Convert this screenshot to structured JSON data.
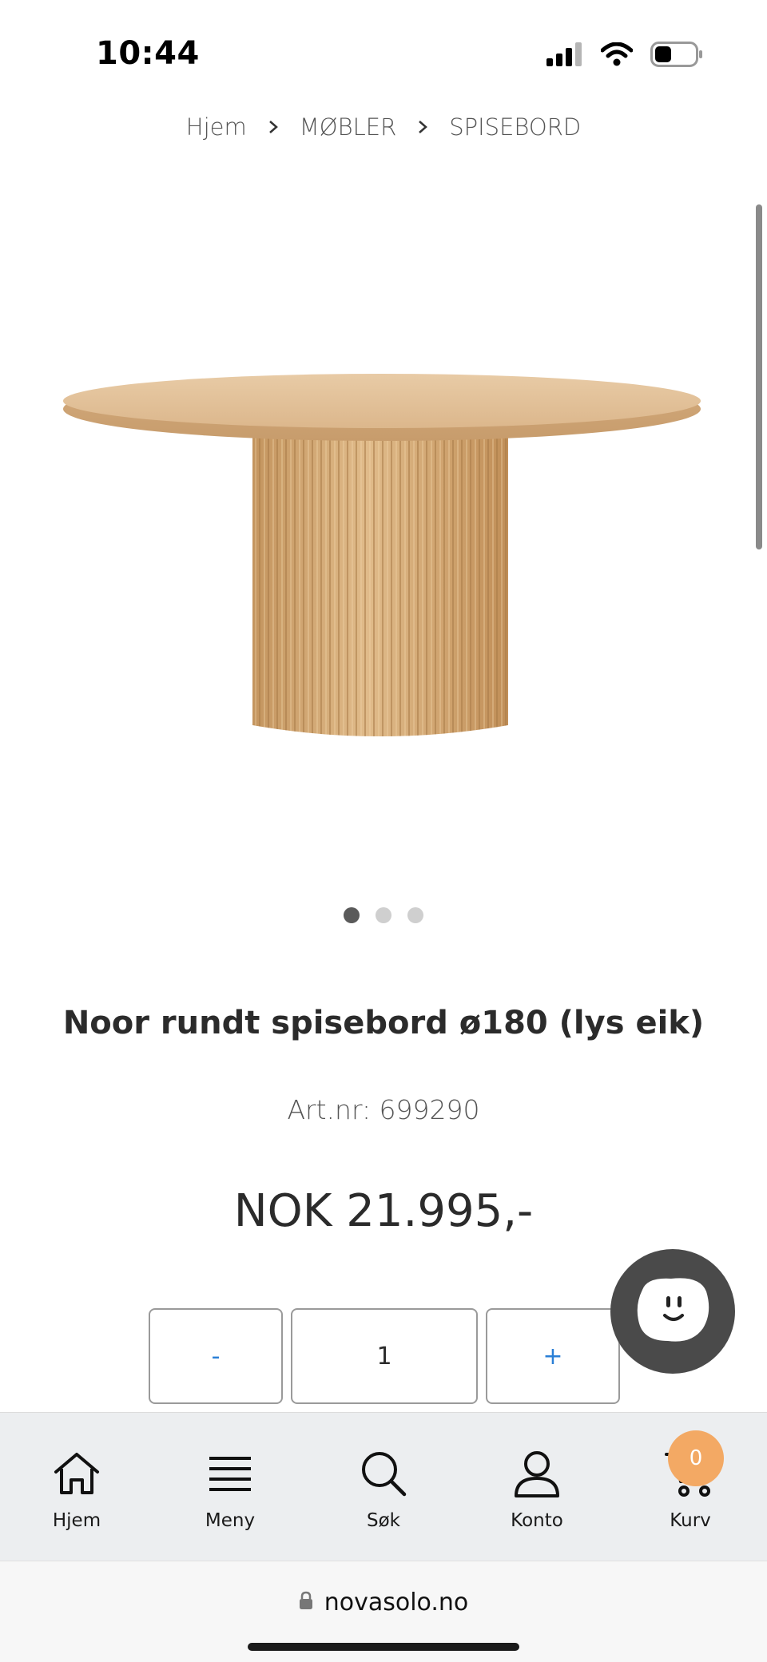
{
  "status_bar": {
    "time": "10:44",
    "icons": [
      "signal-icon",
      "wifi-icon",
      "battery-icon"
    ]
  },
  "breadcrumb": {
    "items": [
      "Hjem",
      "MØBLER",
      "SPISEBORD"
    ]
  },
  "product": {
    "image_alt": "round oak dining table with fluted pedestal",
    "carousel": {
      "total": 3,
      "active": 1
    },
    "title": "Noor rundt spisebord ø180 (lys eik)",
    "art_nr": "Art.nr: 699290",
    "price": "NOK 21.995,-"
  },
  "quantity": {
    "minus_label": "-",
    "value": "1",
    "plus_label": "+"
  },
  "chat": {
    "icon": "chat-face-icon"
  },
  "bottom_nav": {
    "items": [
      {
        "label": "Hjem",
        "icon": "home-icon"
      },
      {
        "label": "Meny",
        "icon": "menu-icon"
      },
      {
        "label": "Søk",
        "icon": "search-icon"
      },
      {
        "label": "Konto",
        "icon": "user-icon"
      },
      {
        "label": "Kurv",
        "icon": "cart-icon"
      }
    ],
    "cart_count": "0"
  },
  "url_bar": {
    "domain": "novasolo.no"
  },
  "colors": {
    "accent_blue": "#2a7fd6",
    "badge_orange": "#f3a964",
    "nav_bg": "#eceef0",
    "wood": "#d7b48a"
  }
}
